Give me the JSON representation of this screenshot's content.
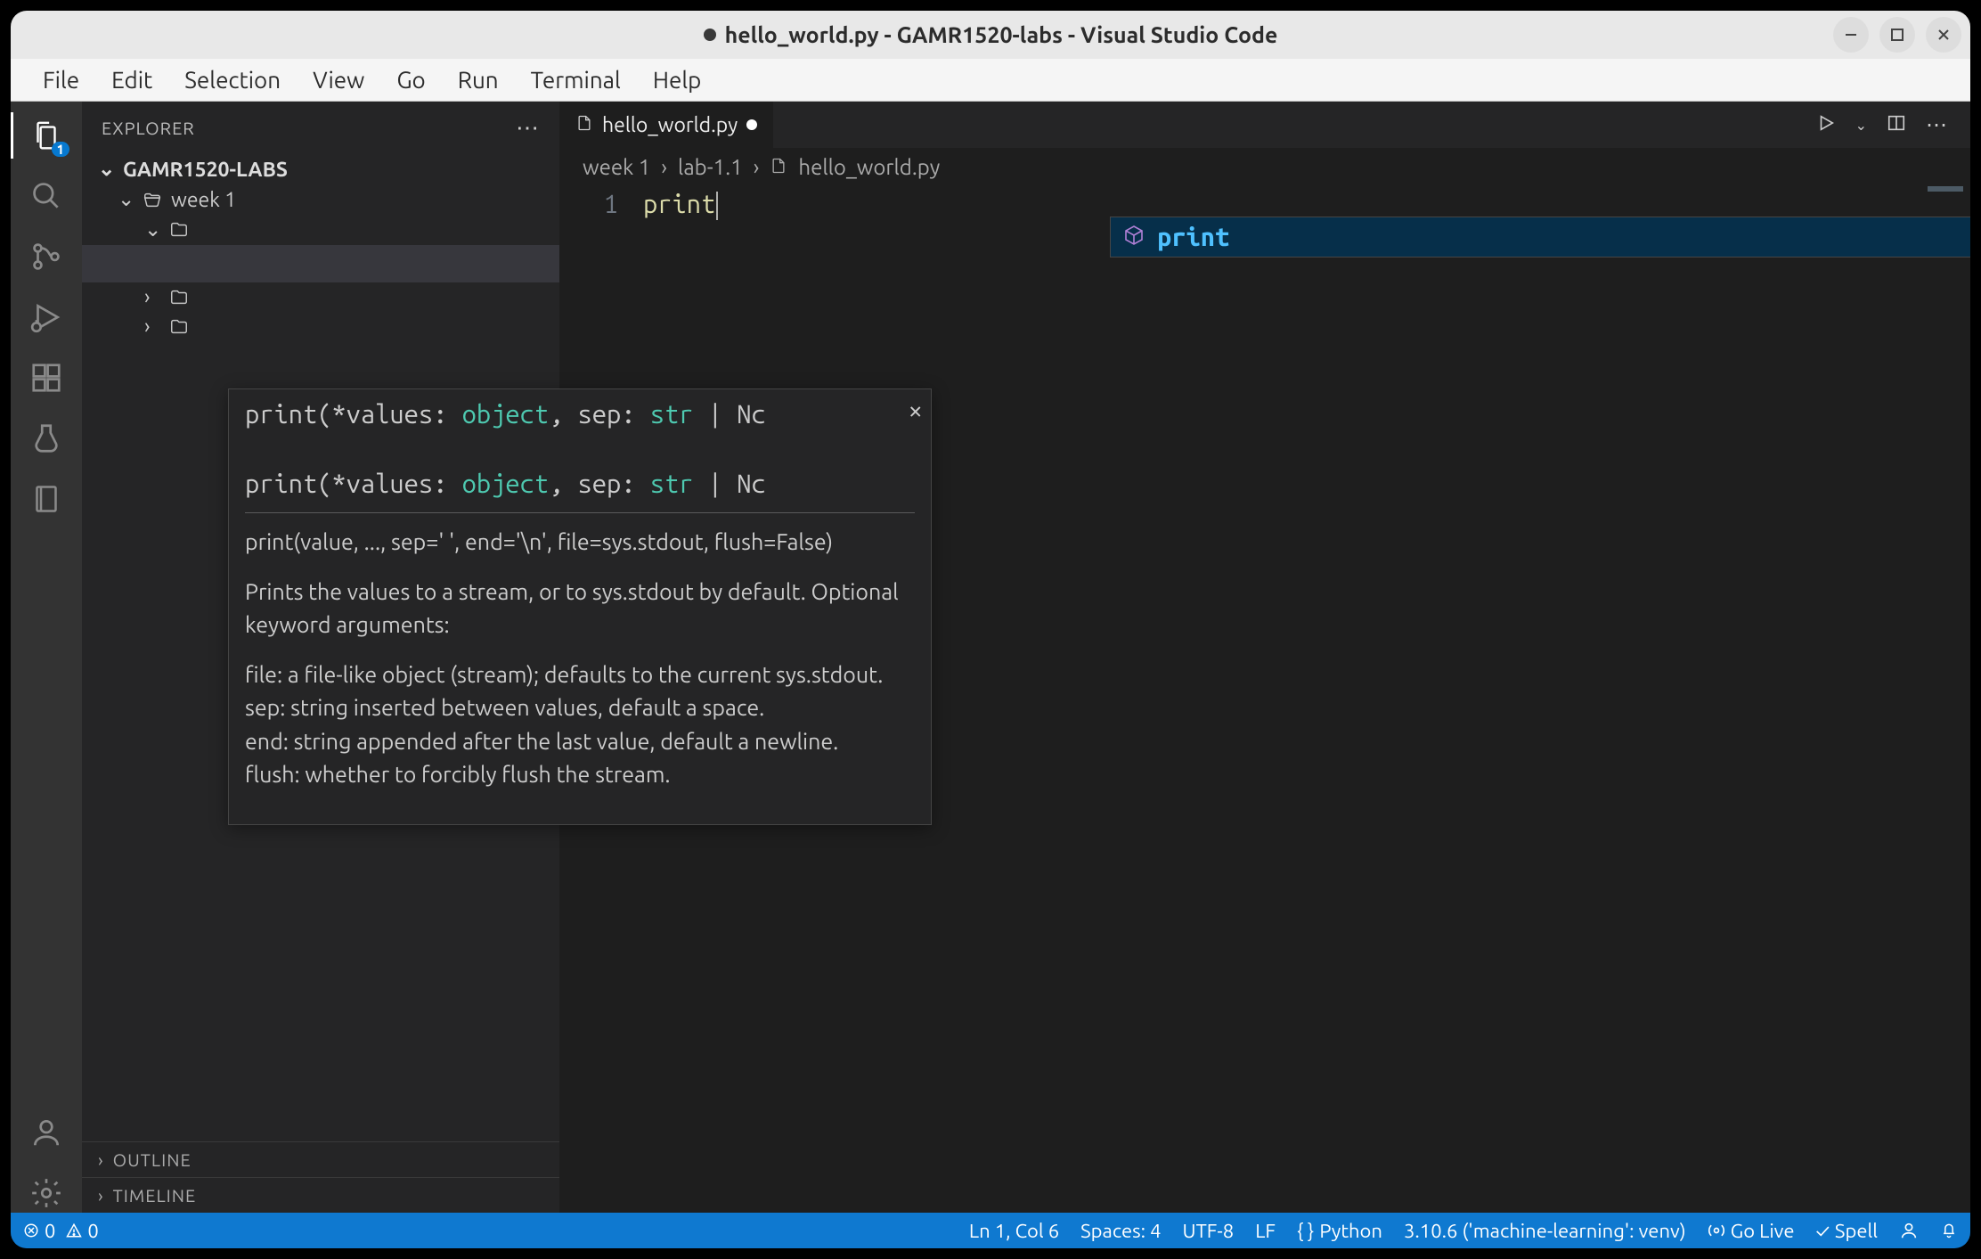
{
  "window": {
    "modified": true,
    "title": "hello_world.py - GAMR1520-labs - Visual Studio Code"
  },
  "menubar": [
    "File",
    "Edit",
    "Selection",
    "View",
    "Go",
    "Run",
    "Terminal",
    "Help"
  ],
  "activity": {
    "badge": "1"
  },
  "sidebar": {
    "title": "EXPLORER",
    "project": "GAMR1520-LABS",
    "tree": {
      "week1": "week 1"
    },
    "outline": "OUTLINE",
    "timeline": "TIMELINE"
  },
  "tabs": {
    "file": "hello_world.py"
  },
  "breadcrumbs": {
    "p1": "week 1",
    "p2": "lab-1.1",
    "p3": "hello_world.py"
  },
  "editor": {
    "line1_num": "1",
    "code": "print"
  },
  "suggest": {
    "item": "print"
  },
  "hover": {
    "sig1_a": "print",
    "sig1_b": "(*values: ",
    "sig1_c": "object",
    "sig1_d": ", sep: ",
    "sig1_e": "str",
    "sig1_f": " | Nc",
    "doc_proto": "print(value, ..., sep=' ', end='\\n', file=sys.stdout, flush=False)",
    "doc_p1": "Prints the values to a stream, or to sys.stdout by default. Optional keyword arguments:",
    "doc_p2": "file: a file-like object (stream); defaults to the current sys.stdout.",
    "doc_p3": "sep: string inserted between values, default a space.",
    "doc_p4": "end: string appended after the last value, default a newline.",
    "doc_p5": "flush: whether to forcibly flush the stream."
  },
  "status": {
    "errors": "0",
    "warnings": "0",
    "ln_col": "Ln 1, Col 6",
    "spaces": "Spaces: 4",
    "encoding": "UTF-8",
    "eol": "LF",
    "lang": "Python",
    "interp": "3.10.6 ('machine-learning': venv)",
    "golive": "Go Live",
    "spell": "Spell"
  }
}
